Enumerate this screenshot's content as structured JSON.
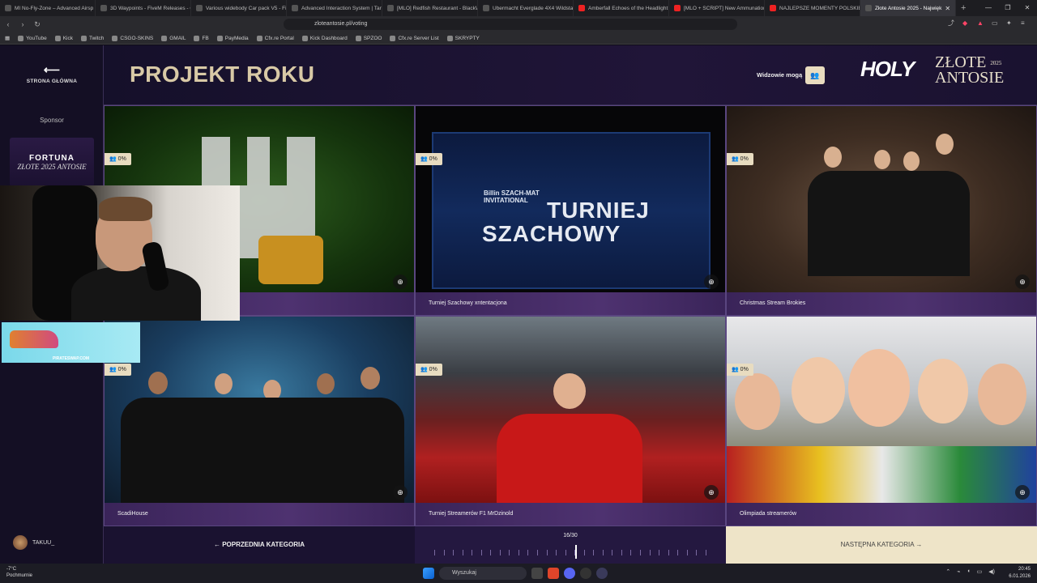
{
  "browser": {
    "tabs": [
      {
        "label": "MI No-Fly-Zone – Advanced Airsp",
        "yt": false
      },
      {
        "label": "3D Waypoints - FiveM Releases - C",
        "yt": false
      },
      {
        "label": "Various widebody Car pack V5 - Fi",
        "yt": false
      },
      {
        "label": "Advanced Interaction System | Targ",
        "yt": false
      },
      {
        "label": "[MLO] Redfish Restaurant - BlackW",
        "yt": false
      },
      {
        "label": "Ubermacht Everglade 4X4 Wildstal",
        "yt": false
      },
      {
        "label": "Amberfall Echoes of the Headlight",
        "yt": true
      },
      {
        "label": "[MLO + SCRIPT] New Ammunation",
        "yt": true
      },
      {
        "label": "NAJLEPSZE MOMENTY POLSKIEGO",
        "yt": true
      },
      {
        "label": "Złote Antosie 2025 - Najwięk",
        "yt": false,
        "active": true
      }
    ],
    "url": "zloteantosie.pl/voting",
    "bookmarks": [
      "YouTube",
      "Kick",
      "Twitch",
      "CSGO-SKINS",
      "GMAIL",
      "FB",
      "PayMedia",
      "Cfx.re Portal",
      "Kick Dashboard",
      "SPZOO",
      "Cfx.re Server List",
      "SKRYPTY"
    ]
  },
  "sidebar": {
    "home_label": "STRONA GŁÓWNA",
    "sponsor_label": "Sponsor",
    "sponsor_name": "FORTUNA",
    "sponsor_sub": "ZŁOTE 2025 ANTOSIE",
    "username": "TAKUU_"
  },
  "header": {
    "title": "PROJEKT ROKU",
    "viewers_label": "Widzowie mogą",
    "logo_holy": "HOLY",
    "logo_zlote": "ZŁOTE",
    "logo_antosie": "ANTOSIE",
    "logo_year": "2025"
  },
  "cards": [
    {
      "caption": "",
      "pct": "0%"
    },
    {
      "caption": "Turniej Szachowy xntentacjona",
      "pct": "0%",
      "banner_title_1": "TURNIEJ",
      "banner_title_2": "SZACHOWY",
      "banner_brand": "Billin SZACH-MAT INVITATIONAL"
    },
    {
      "caption": "Christmas Stream Brokies",
      "pct": "0%"
    },
    {
      "caption": "ScadiHouse",
      "pct": "0%"
    },
    {
      "caption": "Turniej Streamerów F1 MrDzinold",
      "pct": "0%"
    },
    {
      "caption": "Olimpiada streamerów",
      "pct": "0%"
    }
  ],
  "footer": {
    "prev_label": "POPRZEDNIA KATEGORIA",
    "progress_label": "16/30",
    "progress_current": 16,
    "progress_total": 30,
    "next_label": "NASTĘPNA KATEGORIA"
  },
  "overlay": {
    "ad_text": "PIRATESWAP.COM"
  },
  "taskbar": {
    "weather_temp": "-7°C",
    "weather_desc": "Pochmurnie",
    "search_placeholder": "Wyszukaj",
    "time": "20:45",
    "date": "6.01.2026"
  },
  "colors": {
    "accent_gold": "#d8c9a6",
    "caption_purple": "#4e3270",
    "next_button_bg": "#eee4c8"
  }
}
